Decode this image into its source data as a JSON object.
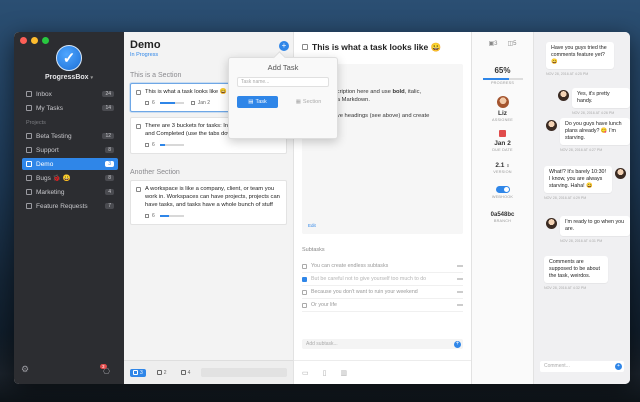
{
  "app": {
    "name": "ProgressBox"
  },
  "sidebar": {
    "top": [
      {
        "label": "Inbox",
        "count": "24"
      },
      {
        "label": "My Tasks",
        "count": "14"
      }
    ],
    "projects_header": "Projects",
    "projects": [
      {
        "label": "Beta Testing",
        "count": "12"
      },
      {
        "label": "Support",
        "count": "8"
      },
      {
        "label": "Demo",
        "count": "3",
        "active": true
      },
      {
        "label": "Bugs 🐞 😀",
        "count": "8"
      },
      {
        "label": "Marketing",
        "count": "4"
      },
      {
        "label": "Feature Requests",
        "count": "7"
      }
    ],
    "notification_count": "3"
  },
  "project": {
    "title": "Demo",
    "status": "In Progress",
    "sections": [
      {
        "title": "This is a Section",
        "cards": [
          {
            "text": "This is what a task looks like 😀",
            "count": "6",
            "date": "Jan 2",
            "progress": 0.65
          },
          {
            "text": "There are 3 buckets for tasks: In Progress, Backlog, and Completed (use the tabs down below)",
            "count": "6",
            "date": "",
            "progress": 0.2
          }
        ]
      },
      {
        "title": "Another Section",
        "cards": [
          {
            "text": "A workspace is like a company, client, or team you work in. Workspaces can have projects, projects can have tasks, and tasks have a whole bunch of stuff",
            "count": "6",
            "date": "",
            "progress": 0.4
          }
        ]
      }
    ],
    "footer": {
      "in_progress": "3",
      "backlog": "2",
      "completed": "4"
    }
  },
  "popover": {
    "title": "Add Task",
    "placeholder": "Task name...",
    "task_label": "Task",
    "section_label": "Section"
  },
  "detail": {
    "title": "This is what a task looks like 😀",
    "desc_line1a": "n put a description here and use ",
    "desc_bold": "bold",
    "desc_line1b": ", italic,",
    "desc_line2a": "ike ",
    "desc_code": "code",
    "desc_line2b": " via Markdown.",
    "desc_line3": "You can have headings (see above) and create",
    "desc_link": "links",
    "desc_link_end": ".",
    "edit_label": "Edit",
    "subtasks_header": "Subtasks",
    "subtasks": [
      {
        "text": "You can create endless subtasks",
        "done": false
      },
      {
        "text": "But be careful not to give yourself too much to do",
        "done": true
      },
      {
        "text": "Because you don't want to ruin your weekend",
        "done": false
      },
      {
        "text": "Or your life",
        "done": false
      }
    ],
    "add_subtask_placeholder": "Add subtask..."
  },
  "stats": {
    "header_counts": [
      "3",
      "5"
    ],
    "progress": "65%",
    "progress_fraction": 0.65,
    "progress_label": "PROGRESS",
    "assignee": "Liz",
    "assignee_label": "ASSIGNEE",
    "due": "Jan 2",
    "due_label": "DUE DATE",
    "version": "2.1",
    "version_label": "VERSION",
    "toggle_label": "WEBHOOK",
    "hash": "0a548bc",
    "hash_label": "BRANCH"
  },
  "comments": [
    {
      "text": "Have you guys tried the comments feature yet? 😀",
      "time": "NOV 28, 2016 AT 4:25 PM",
      "side": "left"
    },
    {
      "text": "Yes, it's pretty handy.",
      "time": "NOV 28, 2016 AT 4:26 PM",
      "side": "right"
    },
    {
      "text": "Do you guys have lunch plans already? 😋 I'm starving.",
      "time": "NOV 28, 2016 AT 4:27 PM",
      "side": "right"
    },
    {
      "text": "What!? It's barely 10:30! I know, you are always starving. Haha! 😀",
      "time": "NOV 28, 2016 AT 4:29 PM",
      "side": "left"
    },
    {
      "text": "I'm ready to go when you are.",
      "time": "NOV 28, 2016 AT 4:31 PM",
      "side": "right"
    },
    {
      "text": "Comments are supposed to be about the task, weirdos.",
      "time": "NOV 28, 2016 AT 4:32 PM",
      "side": "left"
    }
  ],
  "comment_placeholder": "Comment...",
  "colors": {
    "accent": "#2f86e8",
    "sidebar": "#2c2d31"
  }
}
